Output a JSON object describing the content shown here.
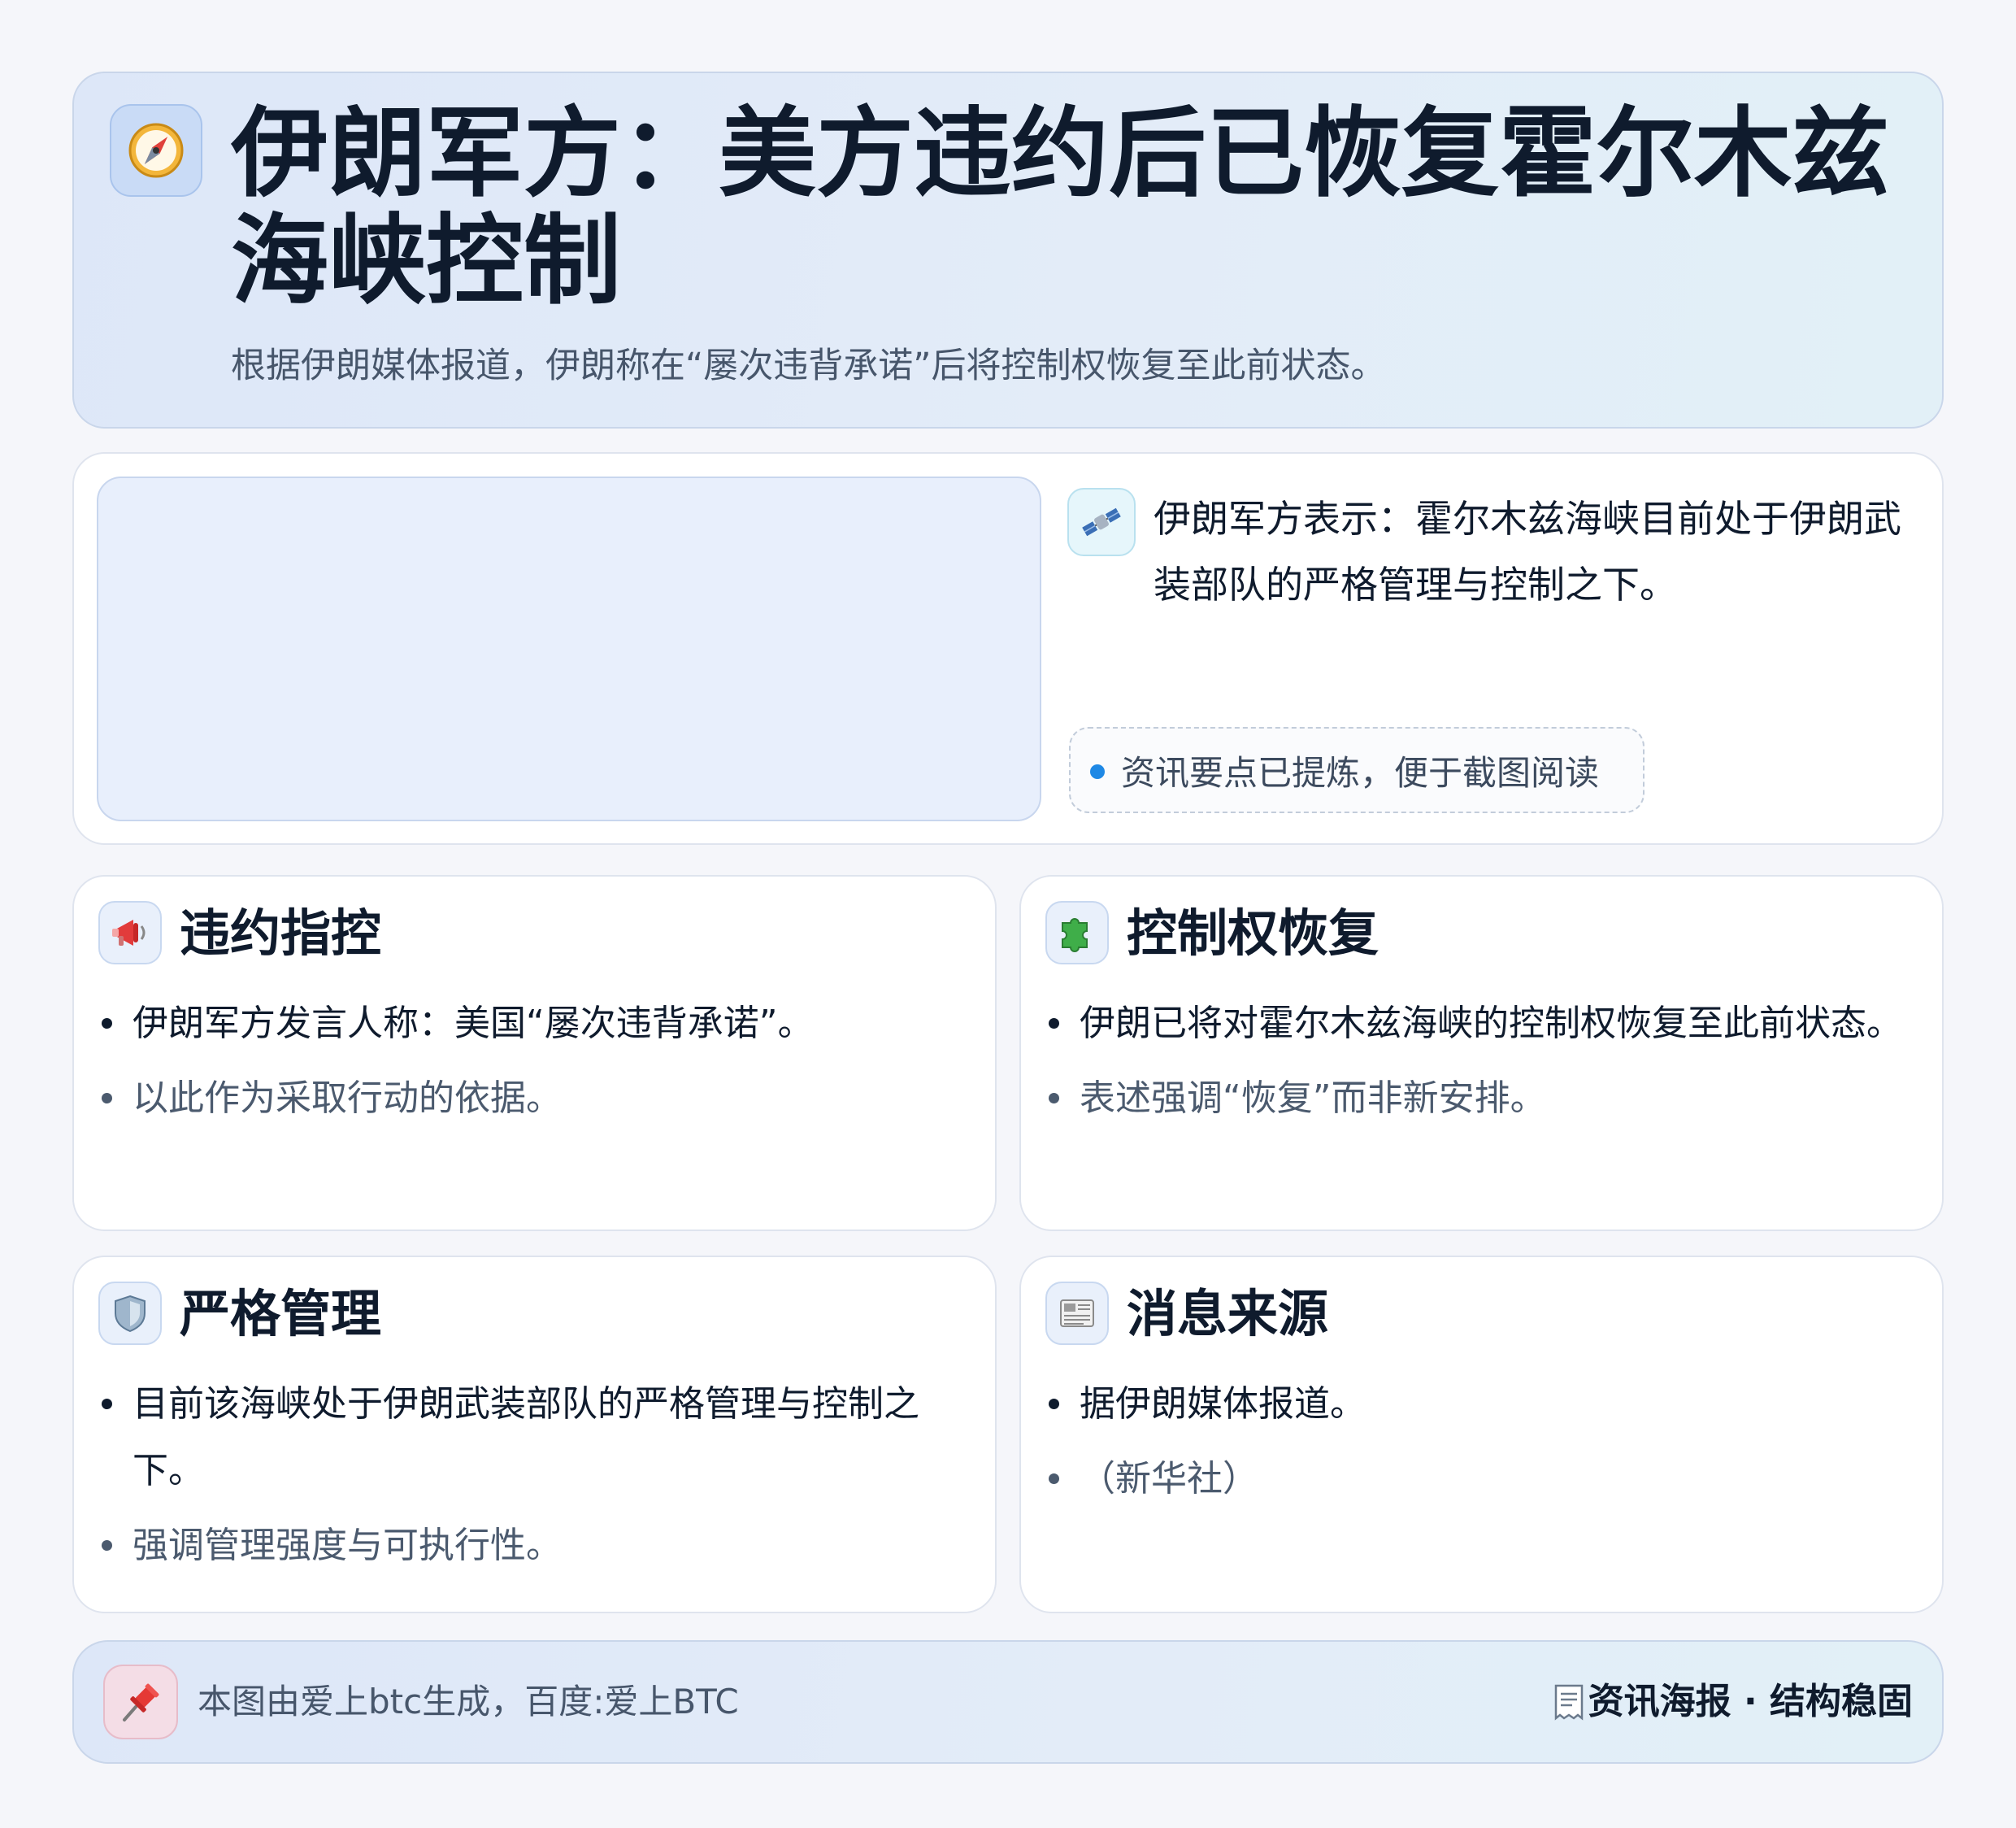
{
  "header": {
    "title": "伊朗军方：美方违约后已恢复霍尔木兹海峡控制",
    "subtitle": "根据伊朗媒体报道，伊朗称在“屡次违背承诺”后将控制权恢复至此前状态。",
    "icon": "compass-icon"
  },
  "intro": {
    "icon": "satellite-icon",
    "text": "伊朗军方表示：霍尔木兹海峡目前处于伊朗武装部队的严格管理与控制之下。",
    "tag": "资讯要点已提炼，便于截图阅读"
  },
  "sections": [
    {
      "icon": "megaphone-icon",
      "title": "违约指控",
      "bullets": [
        "伊朗军方发言人称：美国“屡次违背承诺”。",
        "以此作为采取行动的依据。"
      ]
    },
    {
      "icon": "puzzle-icon",
      "title": "控制权恢复",
      "bullets": [
        "伊朗已将对霍尔木兹海峡的控制权恢复至此前状态。",
        "表述强调“恢复”而非新安排。"
      ]
    },
    {
      "icon": "shield-icon",
      "title": "严格管理",
      "bullets": [
        "目前该海峡处于伊朗武装部队的严格管理与控制之下。",
        "强调管理强度与可执行性。"
      ]
    },
    {
      "icon": "newspaper-icon",
      "title": "消息来源",
      "bullets": [
        "据伊朗媒体报道。",
        "（新华社）"
      ]
    }
  ],
  "footer": {
    "icon": "pushpin-icon",
    "left_text": "本图由爱上btc生成，百度:爱上BTC",
    "right_icon": "receipt-icon",
    "right_text": "资讯海报 · 结构稳固"
  },
  "colors": {
    "accent": "#1e88e5",
    "text": "#0f1b2d",
    "muted": "#4b5a6e",
    "header_bg": "#dfe8f8"
  }
}
